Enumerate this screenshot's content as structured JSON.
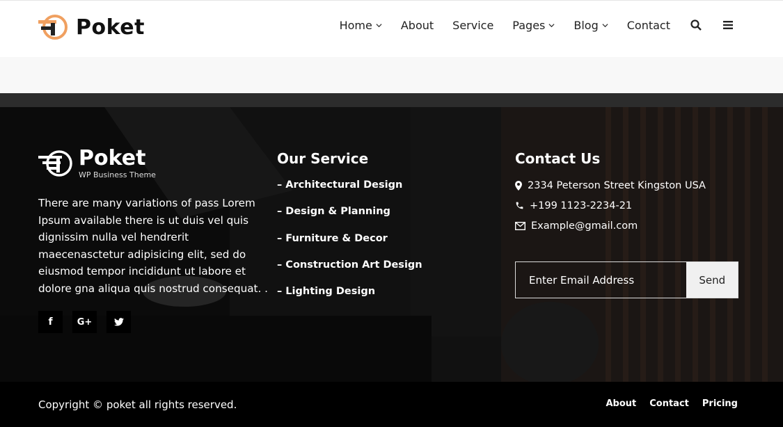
{
  "header": {
    "brand": "Poket",
    "nav": [
      {
        "label": "Home",
        "has_dropdown": true
      },
      {
        "label": "About",
        "has_dropdown": false
      },
      {
        "label": "Service",
        "has_dropdown": false
      },
      {
        "label": "Pages",
        "has_dropdown": true
      },
      {
        "label": "Blog",
        "has_dropdown": true
      },
      {
        "label": "Contact",
        "has_dropdown": false
      }
    ],
    "icons": [
      "search-icon",
      "menu-icon"
    ]
  },
  "footer": {
    "brand": "Poket",
    "tagline": "WP Business Theme",
    "about": "There are many variations of pass Lorem Ipsum available there is ut duis vel quis dignissim nulla vel hendrerit maecenasctetur adipisicing elit, sed do eiusmod tempor incididunt ut labore et dolore gna aliqua quis nostrud consequat. .",
    "socials": [
      "facebook-icon",
      "google-plus-icon",
      "twitter-icon"
    ],
    "service_title": "Our Service",
    "services": [
      "– Architectural Design",
      "– Design & Planning",
      "– Furniture & Decor",
      "– Construction Art Design",
      "– Lighting Design"
    ],
    "contact_title": "Contact Us",
    "address": "2334 Peterson Street Kingston USA",
    "phone": "+199 1123-2234-21",
    "email": "Example@gmail.com",
    "subscribe": {
      "placeholder": "Enter Email Address",
      "button": "Send"
    }
  },
  "bottom": {
    "copyright": "Copyright © poket all rights reserved.",
    "links": [
      "About",
      "Contact",
      "Pricing"
    ]
  },
  "colors": {
    "accent": "#f0a060",
    "footer_bg": "#171717",
    "bottom_bg": "#000000"
  }
}
